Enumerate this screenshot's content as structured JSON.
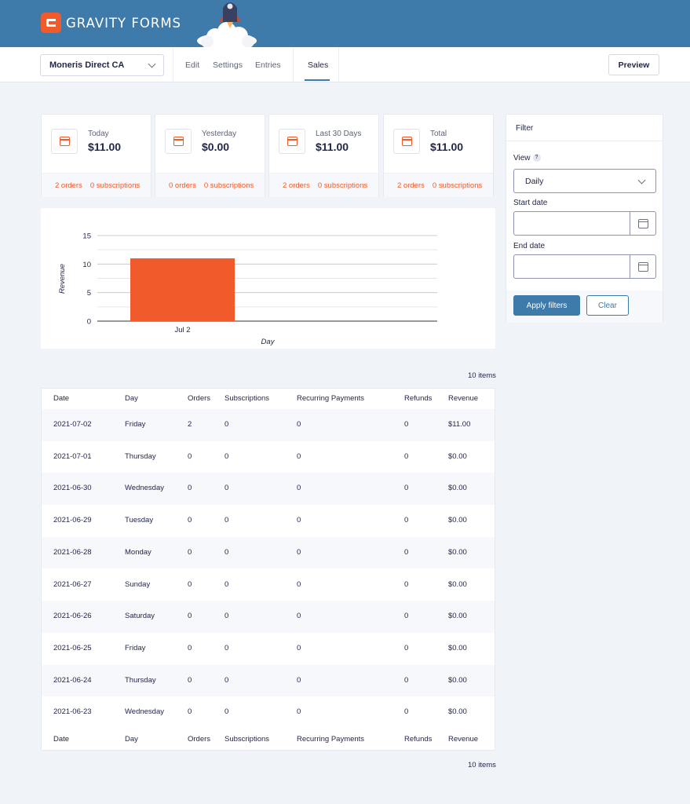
{
  "brand": {
    "name": "GRAVITY FORMS",
    "accent": "#f15a2b",
    "header_bg": "#3e7aaa"
  },
  "nav": {
    "form_select": "Moneris Direct CA",
    "links": [
      "Edit",
      "Settings",
      "Entries",
      "Sales"
    ],
    "active": "Sales",
    "preview": "Preview"
  },
  "stats": [
    {
      "label": "Today",
      "value": "$11.00",
      "orders": "2 orders",
      "subscriptions": "0 subscriptions"
    },
    {
      "label": "Yesterday",
      "value": "$0.00",
      "orders": "0 orders",
      "subscriptions": "0 subscriptions"
    },
    {
      "label": "Last 30 Days",
      "value": "$11.00",
      "orders": "2 orders",
      "subscriptions": "0 subscriptions"
    },
    {
      "label": "Total",
      "value": "$11.00",
      "orders": "2 orders",
      "subscriptions": "0 subscriptions"
    }
  ],
  "filter": {
    "title": "Filter",
    "view_label": "View",
    "help": "?",
    "view_value": "Daily",
    "start_label": "Start date",
    "start_value": "",
    "end_label": "End date",
    "end_value": "",
    "apply": "Apply filters",
    "clear": "Clear"
  },
  "chart_data": {
    "type": "bar",
    "categories": [
      "Jul 2"
    ],
    "values": [
      11
    ],
    "xlabel": "Day",
    "ylabel": "Revenue",
    "ylim": [
      0,
      15
    ],
    "yticks": [
      "0",
      "5",
      "10",
      "15"
    ],
    "grid": true,
    "bar_color": "#f15a2b"
  },
  "table": {
    "items_label": "10 items",
    "columns": [
      "Date",
      "Day",
      "Orders",
      "Subscriptions",
      "Recurring Payments",
      "Refunds",
      "Revenue"
    ],
    "rows": [
      [
        "2021-07-02",
        "Friday",
        "2",
        "0",
        "0",
        "0",
        "$11.00"
      ],
      [
        "2021-07-01",
        "Thursday",
        "0",
        "0",
        "0",
        "0",
        "$0.00"
      ],
      [
        "2021-06-30",
        "Wednesday",
        "0",
        "0",
        "0",
        "0",
        "$0.00"
      ],
      [
        "2021-06-29",
        "Tuesday",
        "0",
        "0",
        "0",
        "0",
        "$0.00"
      ],
      [
        "2021-06-28",
        "Monday",
        "0",
        "0",
        "0",
        "0",
        "$0.00"
      ],
      [
        "2021-06-27",
        "Sunday",
        "0",
        "0",
        "0",
        "0",
        "$0.00"
      ],
      [
        "2021-06-26",
        "Saturday",
        "0",
        "0",
        "0",
        "0",
        "$0.00"
      ],
      [
        "2021-06-25",
        "Friday",
        "0",
        "0",
        "0",
        "0",
        "$0.00"
      ],
      [
        "2021-06-24",
        "Thursday",
        "0",
        "0",
        "0",
        "0",
        "$0.00"
      ],
      [
        "2021-06-23",
        "Wednesday",
        "0",
        "0",
        "0",
        "0",
        "$0.00"
      ]
    ]
  }
}
